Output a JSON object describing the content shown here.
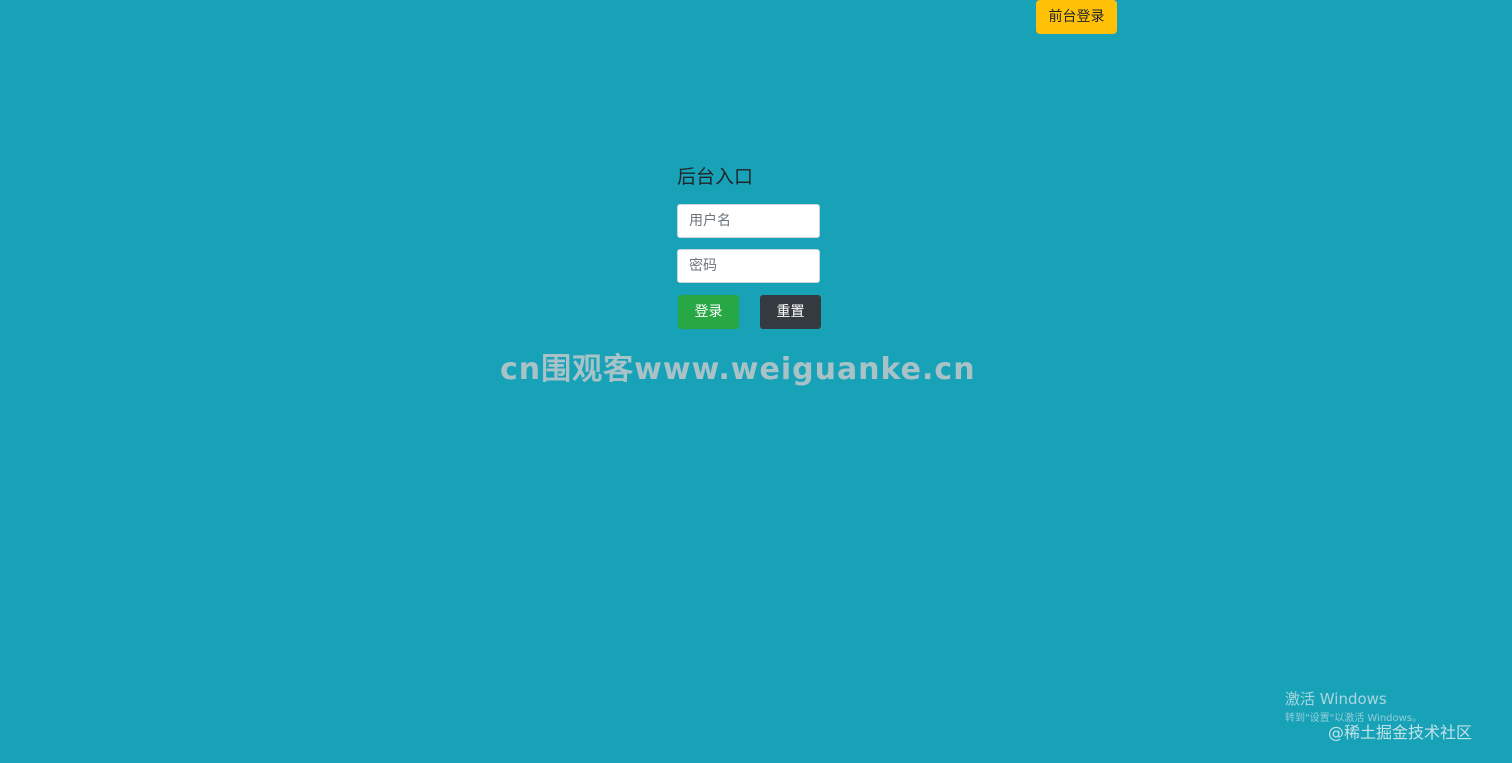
{
  "header": {
    "front_login_label": "前台登录"
  },
  "login_form": {
    "title": "后台入口",
    "username_placeholder": "用户名",
    "password_placeholder": "密码",
    "login_label": "登录",
    "reset_label": "重置"
  },
  "watermark": {
    "text": "cn围观客www.weiguanke.cn"
  },
  "os_overlay": {
    "activate_title": "激活 Windows",
    "activate_subtitle": "转到\"设置\"以激活 Windows。"
  },
  "footer": {
    "site_credit": "@稀土掘金技术社区"
  },
  "colors": {
    "background": "#17a2b8",
    "front_login_button": "#ffc107",
    "login_button": "#28a745",
    "reset_button": "#343a40"
  }
}
